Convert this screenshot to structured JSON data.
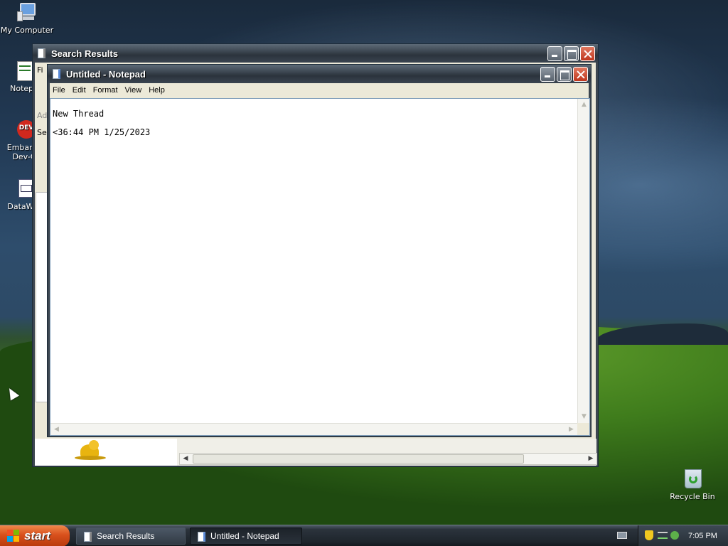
{
  "desktop": {
    "icons": [
      {
        "label": "My Computer",
        "icon": "computer-icon"
      },
      {
        "label": "Notepa",
        "icon": "notepad-shortcut-icon"
      },
      {
        "label": "Embarca",
        "label2": "Dev-C",
        "icon": "devcpp-icon",
        "badge": "DEV"
      },
      {
        "label": "DataWa",
        "icon": "datawave-icon"
      },
      {
        "label": "Recycle Bin",
        "icon": "recycle-bin-icon"
      }
    ]
  },
  "search_window": {
    "title": "Search Results",
    "menu_partial": "Fi",
    "address_partial": "Ad",
    "search_partial": "Se"
  },
  "notepad": {
    "title": "Untitled - Notepad",
    "menu": [
      "File",
      "Edit",
      "Format",
      "View",
      "Help"
    ],
    "content_line1": "New Thread",
    "content_line2": "<36:44 PM 1/25/2023"
  },
  "taskbar": {
    "start_label": "start",
    "buttons": [
      {
        "label": "Search Results",
        "active": false
      },
      {
        "label": "Untitled - Notepad",
        "active": true
      }
    ],
    "clock": "7:05 PM"
  },
  "colors": {
    "start_button": "#d8501c",
    "title_bar": "#3c4651",
    "close_button": "#c0361d"
  }
}
